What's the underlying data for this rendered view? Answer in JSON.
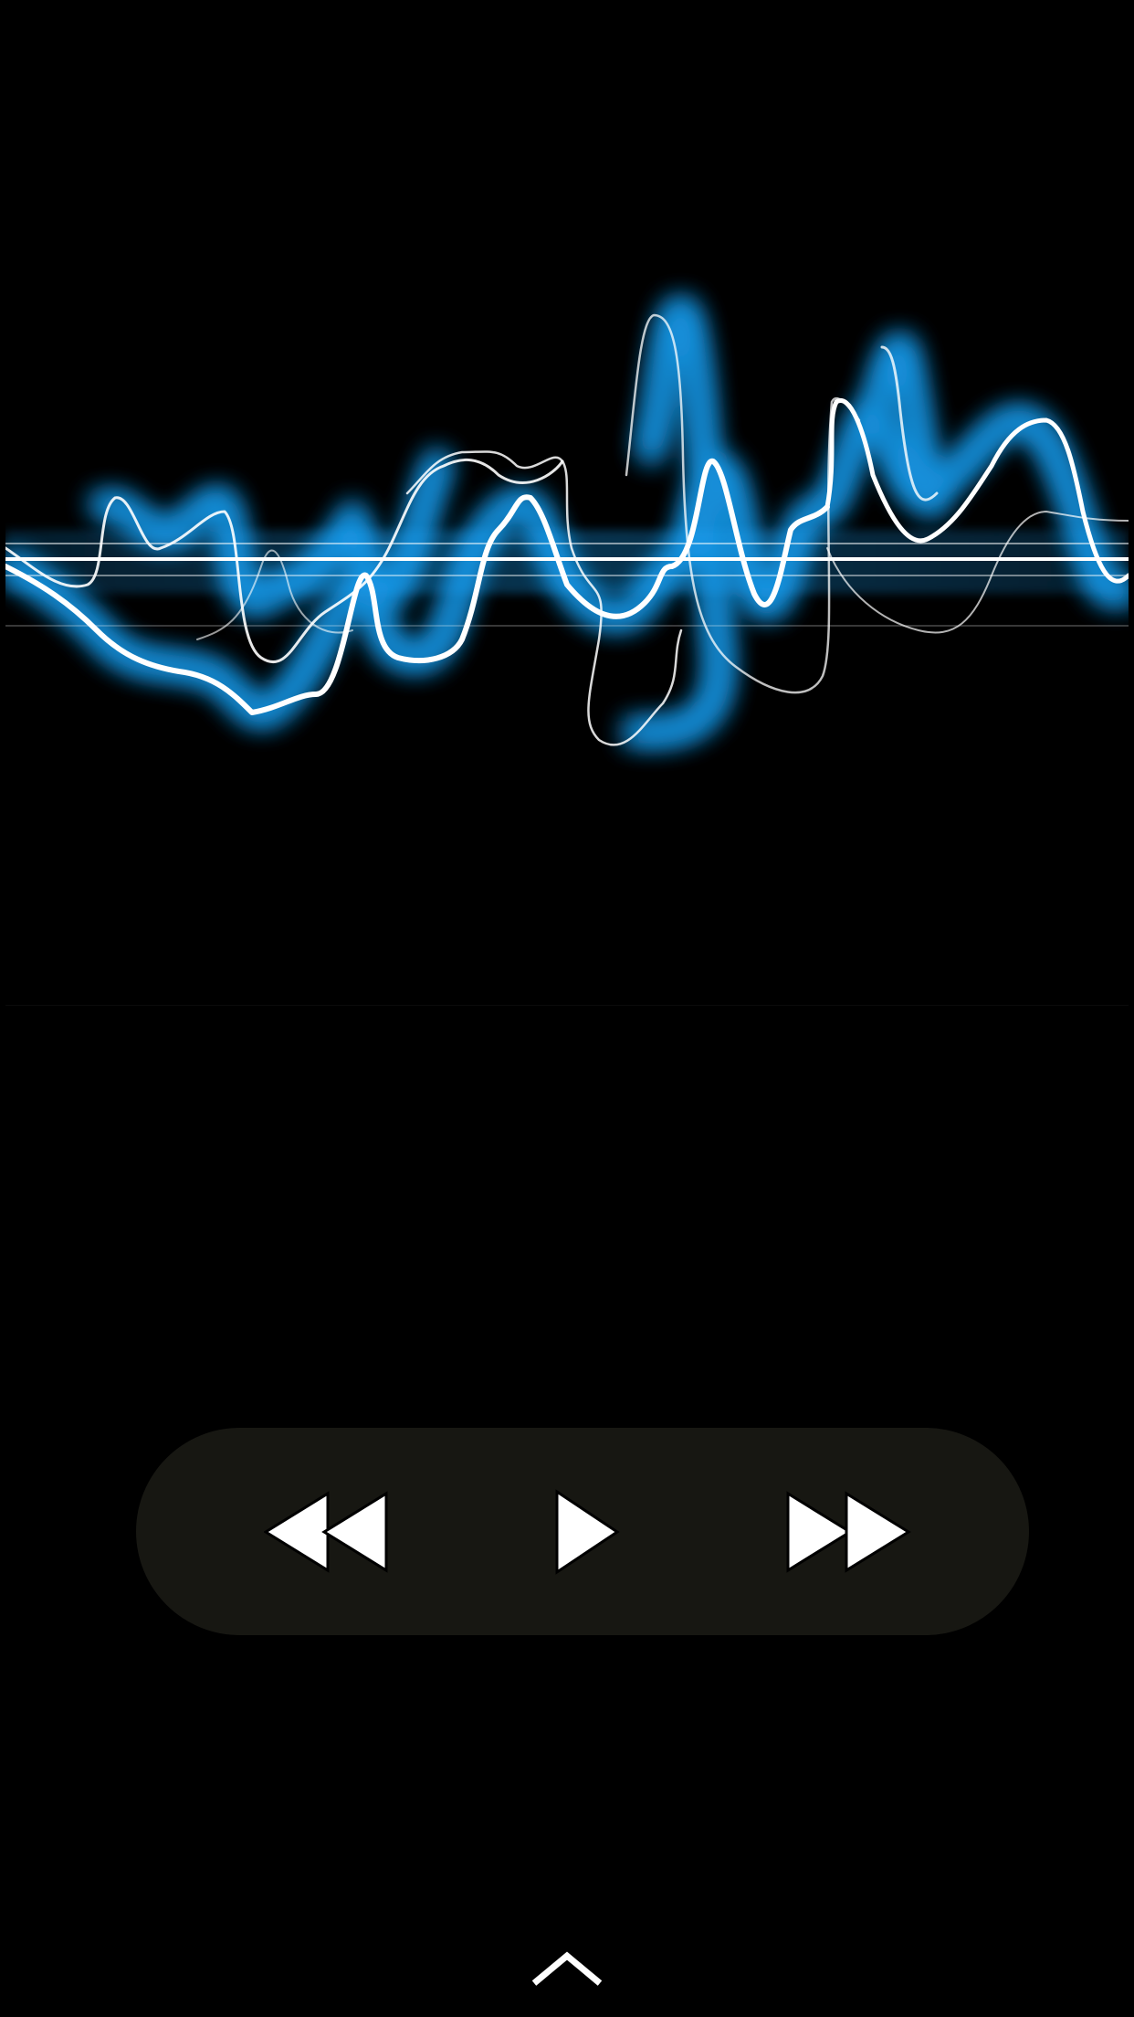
{
  "screen": {
    "background_color": "#000000"
  },
  "artwork": {
    "icon": "sound-wave-artwork",
    "glow_color": "#1aa7ff",
    "line_color": "#ffffff"
  },
  "player_controls": {
    "background_color": "#171712",
    "buttons": [
      {
        "id": "rewind",
        "icon": "rewind-icon"
      },
      {
        "id": "play",
        "icon": "play-icon"
      },
      {
        "id": "fast-forward",
        "icon": "fast-forward-icon"
      }
    ]
  },
  "footer": {
    "expand_icon": "chevron-up-icon"
  }
}
